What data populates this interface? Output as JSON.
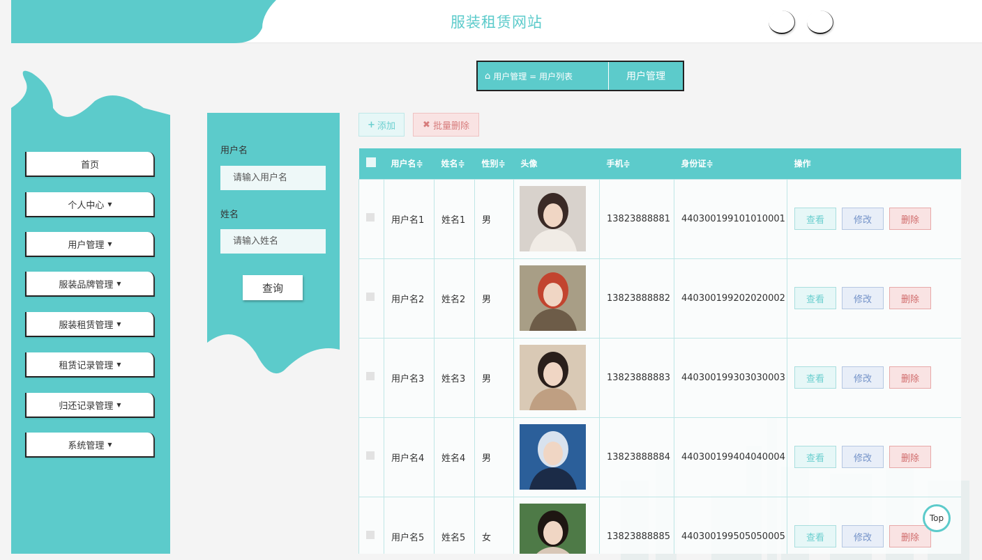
{
  "header": {
    "title": "服装租赁网站"
  },
  "breadcrumb": {
    "path": "用户管理 = 用户列表",
    "current": "用户管理"
  },
  "sidebar": {
    "items": [
      {
        "label": "首页",
        "caret": ""
      },
      {
        "label": "个人中心",
        "caret": "▼"
      },
      {
        "label": "用户管理",
        "caret": "▼"
      },
      {
        "label": "服装品牌管理",
        "caret": "▼"
      },
      {
        "label": "服装租赁管理",
        "caret": "▼"
      },
      {
        "label": "租赁记录管理",
        "caret": "▼"
      },
      {
        "label": "归还记录管理",
        "caret": "▼"
      },
      {
        "label": "系统管理",
        "caret": "▼"
      }
    ]
  },
  "search": {
    "username_label": "用户名",
    "username_placeholder": "请输入用户名",
    "name_label": "姓名",
    "name_placeholder": "请输入姓名",
    "button": "查询"
  },
  "toolbar": {
    "add": "添加",
    "batch_delete": "批量删除"
  },
  "table": {
    "headers": [
      "用户名≑",
      "姓名≑",
      "性别≑",
      "头像",
      "手机≑",
      "身份证≑",
      "操作"
    ],
    "actions": {
      "view": "查看",
      "edit": "修改",
      "delete": "删除"
    },
    "rows": [
      {
        "username": "用户名1",
        "name": "姓名1",
        "gender": "男",
        "phone": "13823888881",
        "id_card": "440300199101010001"
      },
      {
        "username": "用户名2",
        "name": "姓名2",
        "gender": "男",
        "phone": "13823888882",
        "id_card": "440300199202020002"
      },
      {
        "username": "用户名3",
        "name": "姓名3",
        "gender": "男",
        "phone": "13823888883",
        "id_card": "440300199303030003"
      },
      {
        "username": "用户名4",
        "name": "姓名4",
        "gender": "男",
        "phone": "13823888884",
        "id_card": "440300199404040004"
      },
      {
        "username": "用户名5",
        "name": "姓名5",
        "gender": "女",
        "phone": "13823888885",
        "id_card": "440300199505050005"
      }
    ]
  },
  "top_button": "Top",
  "colors": {
    "accent": "#5ccbcb",
    "danger": "#d06b6b",
    "edit": "#7392c8"
  }
}
